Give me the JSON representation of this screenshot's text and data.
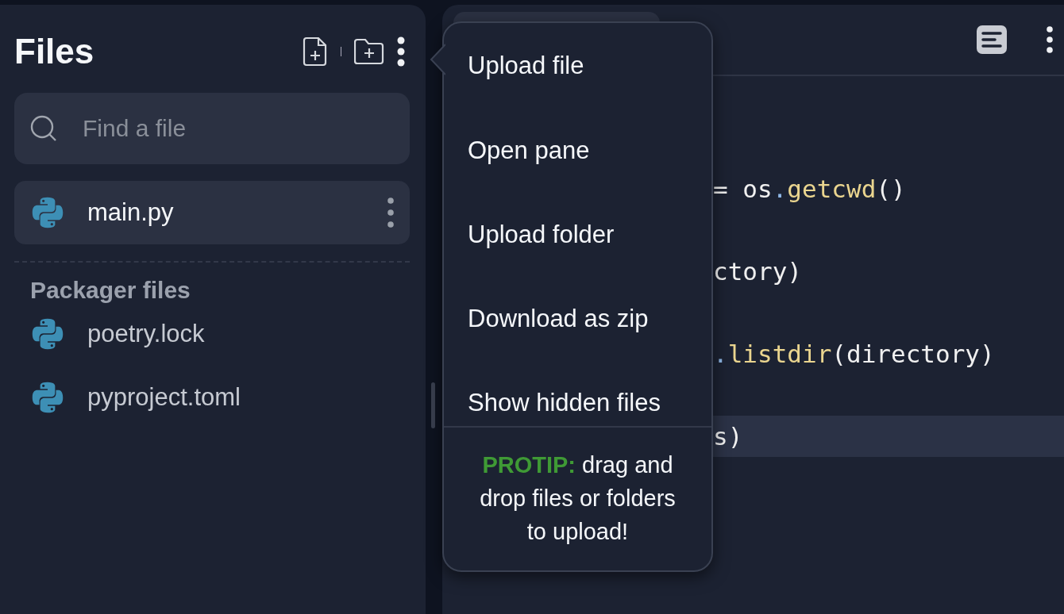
{
  "files_panel": {
    "title": "Files",
    "search": {
      "placeholder": "Find a file"
    },
    "files": [
      {
        "name": "main.py",
        "selected": true
      }
    ],
    "packager": {
      "title": "Packager files",
      "files": [
        {
          "name": "poetry.lock",
          "selected": false
        },
        {
          "name": "pyproject.toml",
          "selected": false
        }
      ]
    }
  },
  "editor": {
    "lines": [
      {
        "current": false,
        "tokens": [
          {
            "kind": "plain",
            "text": "= os"
          },
          {
            "kind": "punct",
            "text": "."
          },
          {
            "kind": "func",
            "text": "getcwd"
          },
          {
            "kind": "plain",
            "text": "()"
          }
        ]
      },
      {
        "current": false,
        "tokens": [
          {
            "kind": "plain",
            "text": "ctory)"
          }
        ]
      },
      {
        "current": false,
        "tokens": [
          {
            "kind": "punct",
            "text": "."
          },
          {
            "kind": "func",
            "text": "listdir"
          },
          {
            "kind": "plain",
            "text": "(directory)"
          }
        ]
      },
      {
        "current": true,
        "tokens": [
          {
            "kind": "plain",
            "text": "s)"
          }
        ]
      }
    ]
  },
  "menu": {
    "items": [
      "Upload file",
      "Open pane",
      "Upload folder",
      "Download as zip",
      "Show hidden files"
    ],
    "protip": "**PROTIP:** drag and drop files or folders to upload!"
  }
}
